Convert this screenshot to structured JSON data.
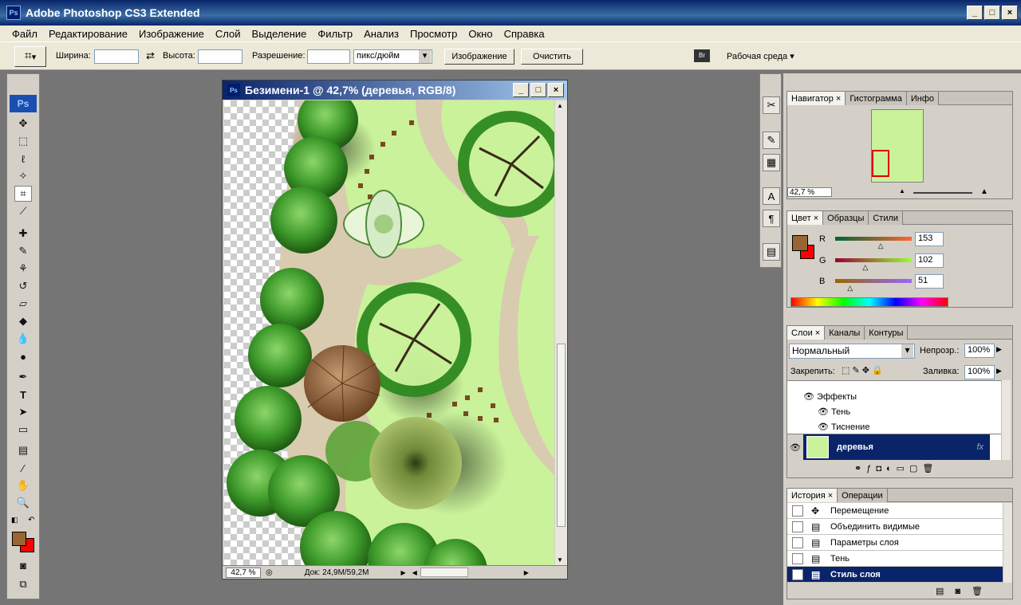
{
  "app": {
    "title": "Adobe Photoshop CS3 Extended",
    "logo": "Ps"
  },
  "menu": [
    "Файл",
    "Редактирование",
    "Изображение",
    "Слой",
    "Выделение",
    "Фильтр",
    "Анализ",
    "Просмотр",
    "Окно",
    "Справка"
  ],
  "options": {
    "width_label": "Ширина:",
    "height_label": "Высота:",
    "resolution_label": "Разрешение:",
    "units": "пикс/дюйм",
    "image_btn": "Изображение",
    "clear_btn": "Очистить",
    "workspace": "Рабочая среда"
  },
  "document": {
    "title": "Безимени-1 @ 42,7% (деревья, RGB/8)",
    "zoom": "42,7 %",
    "doc_info": "Док: 24,9M/59,2M"
  },
  "navigator": {
    "tabs": [
      "Навигатор",
      "Гистограмма",
      "Инфо"
    ],
    "zoom": "42,7 %"
  },
  "color": {
    "tabs": [
      "Цвет",
      "Образцы",
      "Стили"
    ],
    "r_label": "R",
    "g_label": "G",
    "b_label": "B",
    "r": "153",
    "g": "102",
    "b": "51",
    "r_level": 0.6,
    "g_level": 0.4,
    "b_level": 0.2,
    "fg": "#996633",
    "bg": "#ff0000"
  },
  "layers": {
    "tabs": [
      "Слои",
      "Каналы",
      "Контуры"
    ],
    "blend": "Нормальный",
    "opacity_label": "Непрозр.:",
    "opacity": "100%",
    "lock_label": "Закрепить:",
    "fill_label": "Заливка:",
    "fill": "100%",
    "effects": "Эффекты",
    "effect1": "Тень",
    "effect2": "Тиснение",
    "layer_name": "деревья"
  },
  "history": {
    "tabs": [
      "История",
      "Операции"
    ],
    "items": [
      "Перемещение",
      "Объединить видимые",
      "Параметры слоя",
      "Тень",
      "Стиль слоя"
    ]
  }
}
